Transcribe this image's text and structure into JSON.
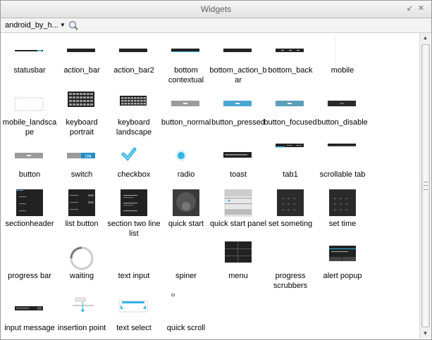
{
  "window": {
    "title": "Widgets"
  },
  "toolbar": {
    "theme_select": "android_by_h...",
    "search_icon": "search-icon"
  },
  "colors": {
    "titlebar": "#e9e9e9",
    "selection": "#33b5e5",
    "dark": "#222222"
  },
  "widgets": [
    {
      "label": "statusbar",
      "kind": "thinbar"
    },
    {
      "label": "action_bar",
      "kind": "bar"
    },
    {
      "label": "action_bar2",
      "kind": "bar"
    },
    {
      "label": "bottom contextual",
      "kind": "bar-blue"
    },
    {
      "label": "bottom_action_bar",
      "kind": "bar"
    },
    {
      "label": "bottom_back",
      "kind": "bar-dots"
    },
    {
      "label": "mobile",
      "kind": "blank-tall"
    },
    {
      "label": "mobile_landscape",
      "kind": "outline"
    },
    {
      "label": "keyboard portrait",
      "kind": "keyboard"
    },
    {
      "label": "keyboard landscape",
      "kind": "keyboard-wide"
    },
    {
      "label": "button_normal",
      "kind": "btn-gray"
    },
    {
      "label": "button_pressed",
      "kind": "btn-blue"
    },
    {
      "label": "button_focused",
      "kind": "btn-teal"
    },
    {
      "label": "button_disable",
      "kind": "btn-dark"
    },
    {
      "label": "button",
      "kind": "btn-gray"
    },
    {
      "label": "switch",
      "kind": "switch"
    },
    {
      "label": "checkbox",
      "kind": "checkbox"
    },
    {
      "label": "radio",
      "kind": "radio"
    },
    {
      "label": "toast",
      "kind": "toast"
    },
    {
      "label": "tab1",
      "kind": "tab"
    },
    {
      "label": "scrollable tab",
      "kind": "tab-dark"
    },
    {
      "label": "sectionheader",
      "kind": "list-dark"
    },
    {
      "label": "list button",
      "kind": "list-btn"
    },
    {
      "label": "section two line list",
      "kind": "list-dark2"
    },
    {
      "label": "quick start",
      "kind": "quickstart"
    },
    {
      "label": "quick start panel",
      "kind": "panel"
    },
    {
      "label": "set someting",
      "kind": "picker"
    },
    {
      "label": "set time",
      "kind": "picker"
    },
    {
      "label": "progress bar",
      "kind": "empty"
    },
    {
      "label": "waiting",
      "kind": "spinner"
    },
    {
      "label": "text input",
      "kind": "empty"
    },
    {
      "label": "spiner",
      "kind": "empty"
    },
    {
      "label": "menu",
      "kind": "menu"
    },
    {
      "label": "progress scrubbers",
      "kind": "empty"
    },
    {
      "label": "alert popup",
      "kind": "alert"
    },
    {
      "label": "input message",
      "kind": "input-msg"
    },
    {
      "label": "insertion point",
      "kind": "insertion"
    },
    {
      "label": "text select",
      "kind": "textselect"
    },
    {
      "label": "quick scroll",
      "kind": "quickscroll"
    }
  ]
}
